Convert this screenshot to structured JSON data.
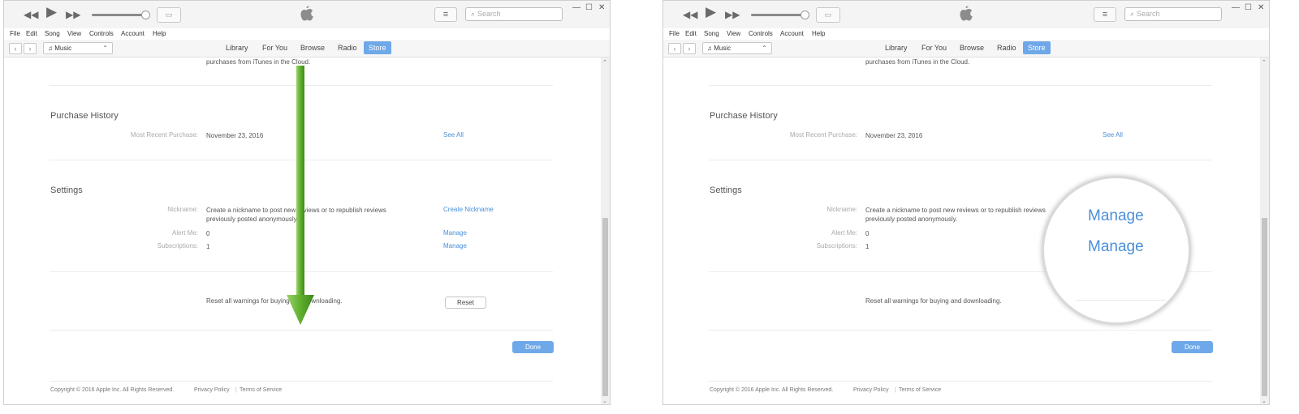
{
  "toolbar": {
    "rewind_glyph": "◀◀",
    "play_glyph": "▶",
    "forward_glyph": "▶▶",
    "airplay_glyph": "▭",
    "list_glyph": "≡",
    "search_placeholder": "Search",
    "minimize_glyph": "—",
    "maximize_glyph": "☐",
    "close_glyph": "✕"
  },
  "menu": [
    "File",
    "Edit",
    "Song",
    "View",
    "Controls",
    "Account",
    "Help"
  ],
  "nav": {
    "back_glyph": "‹",
    "forward_glyph": "›",
    "media_icon": "♫",
    "media_label": "Music",
    "media_chevron": "⌃",
    "tabs": [
      "Library",
      "For You",
      "Browse",
      "Radio",
      "Store"
    ],
    "active_tab": "Store"
  },
  "content": {
    "cloud_text": "purchases from iTunes in the Cloud.",
    "purchase_history": {
      "heading": "Purchase History",
      "label": "Most Recent Purchase:",
      "value": "November 23, 2016",
      "link": "See All"
    },
    "settings": {
      "heading": "Settings",
      "nickname_label": "Nickname:",
      "nickname_text_line1": "Create a nickname to post new reviews or to republish reviews",
      "nickname_text_line2": "previously posted anonymously.",
      "nickname_link": "Create Nickname",
      "alert_label": "Alert Me:",
      "alert_value": "0",
      "alert_link": "Manage",
      "subscriptions_label": "Subscriptions:",
      "subscriptions_value": "1",
      "subscriptions_link": "Manage"
    },
    "reset_text": "Reset all warnings for buying and downloading.",
    "reset_button": "Reset",
    "done_button": "Done",
    "footer": {
      "copyright": "Copyright © 2016 Apple Inc. All Rights Reserved.",
      "privacy": "Privacy Policy",
      "terms": "Terms of Service",
      "separator": "|"
    }
  },
  "scrollbar": {
    "up_glyph": "⌃",
    "down_glyph": "⌄"
  },
  "magnifier": {
    "link1": "Manage",
    "link2": "Manage"
  },
  "colors": {
    "accent": "#6fa8e8",
    "link": "#4a8fd9",
    "arrow": "#5fae2e"
  }
}
